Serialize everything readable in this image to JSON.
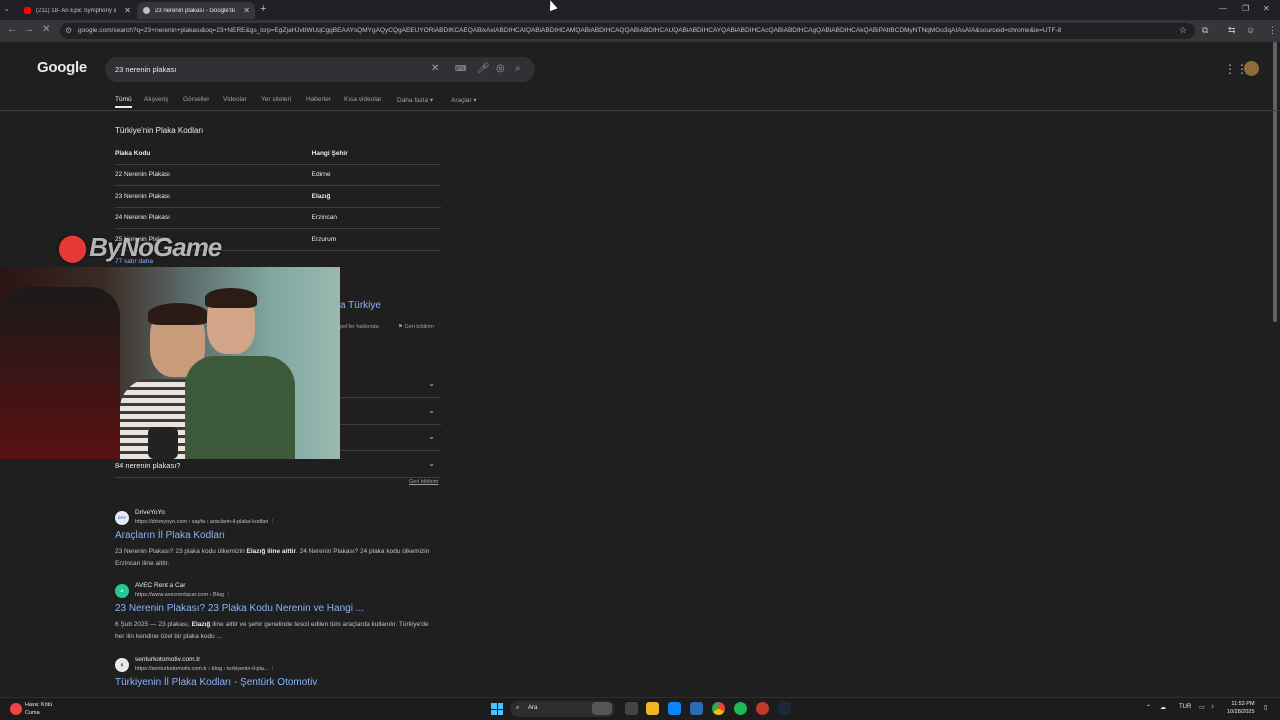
{
  "browser": {
    "tabs": [
      {
        "title": "(211) 18- An Epic Symphony &...",
        "favicon_color": "#ff0000"
      },
      {
        "title": "23 nerenin plakası - Google'da ...",
        "favicon_color": "#bdc1c6"
      }
    ],
    "url": "google.com/search?q=23+nerenin+plakası&oq=23+NERE&gs_lcrp=EgZjaHJvbWUqCggBEAAYsQMYgAQyCQgAEEUYORiABDIKCAEQABixAxiABDIHCAIQABiABDIHCAMQABiABDIHCAQQABiABDIHCAUQABiABDIHCAYQABiABDIHCAcQABiABDIHCAgQABiABDIHCAkQABiPAtIBCDMyNTNqMGo3qAIAsAIA&sourceid=chrome&ie=UTF-8"
  },
  "google": {
    "logo": "Google",
    "query": "23 nerenin plakası",
    "tabs": [
      "Tümü",
      "Alışveriş",
      "Görseller",
      "Videolar",
      "Yer siteleri",
      "Haberler",
      "Kısa videolar",
      "Daha fazla",
      "Araçlar"
    ]
  },
  "featured": {
    "title": "Türkiye'nin Plaka Kodları",
    "headers": [
      "Plaka Kodu",
      "Hangi Şehir"
    ],
    "rows": [
      [
        "22 Nerenin Plakası",
        "Edirne"
      ],
      [
        "23 Nerenin Plakası",
        "Elazığ"
      ],
      [
        "24 Nerenin Plakası",
        "Erzincan"
      ],
      [
        "25 Nerenin Plakası",
        "Erzurum"
      ]
    ],
    "more": "77 satır daha"
  },
  "watermark": "ByNoGame",
  "partial": {
    "link": "a Türkiye",
    "meta": "pet'ler hakkında",
    "feedback": "Geri bildirim"
  },
  "paa": {
    "last_question": "84 nerenin plakası?",
    "feedback": "Geri bildirim"
  },
  "results": [
    {
      "site": "DriveYoYo",
      "cite": "https://driveyoyo.com › sayfa › araclarin-il-plaka-kodlari",
      "title": "Araçların İl Plaka Kodları",
      "snippet_a": "23 Nerenin Plakası? 23 plaka kodu ülkemizin ",
      "snippet_b": "Elazığ iline aittir",
      "snippet_c": ". 24 Nerenin Plakası? 24 plaka kodu ülkemizin Erzincan iline aittir.",
      "favicon": "DYY"
    },
    {
      "site": "AVEC Rent a Car",
      "cite": "https://www.avecrentacar.com › Blog",
      "title": "23 Nerenin Plakası? 23 Plaka Kodu Nerenin ve Hangi ...",
      "snippet_a": "6 Şub 2025 — 23 plakası, ",
      "snippet_b": "Elazığ",
      "snippet_c": " iline aittir ve şehir genelinde tescil edilen tüm araçlarda kullanılır. Türkiye'de her ilin kendine özel bir plaka kodu ...",
      "favicon": "A"
    },
    {
      "site": "senturkotomotiv.com.tr",
      "cite": "https://senturkotomotiv.com.tr › blog › turkiyenin-il-pla...",
      "title": "Türkiyenin İl Plaka Kodları - Şentürk Otomotiv",
      "snippet_a": "",
      "snippet_b": "",
      "snippet_c": "",
      "favicon": "Ş"
    }
  ],
  "taskbar": {
    "weather_line1": "Hava: Kötü",
    "weather_line2": "Cuma",
    "search": "Ara",
    "lang": "TUR",
    "time": "11:53 PM",
    "date": "10/28/2025"
  }
}
